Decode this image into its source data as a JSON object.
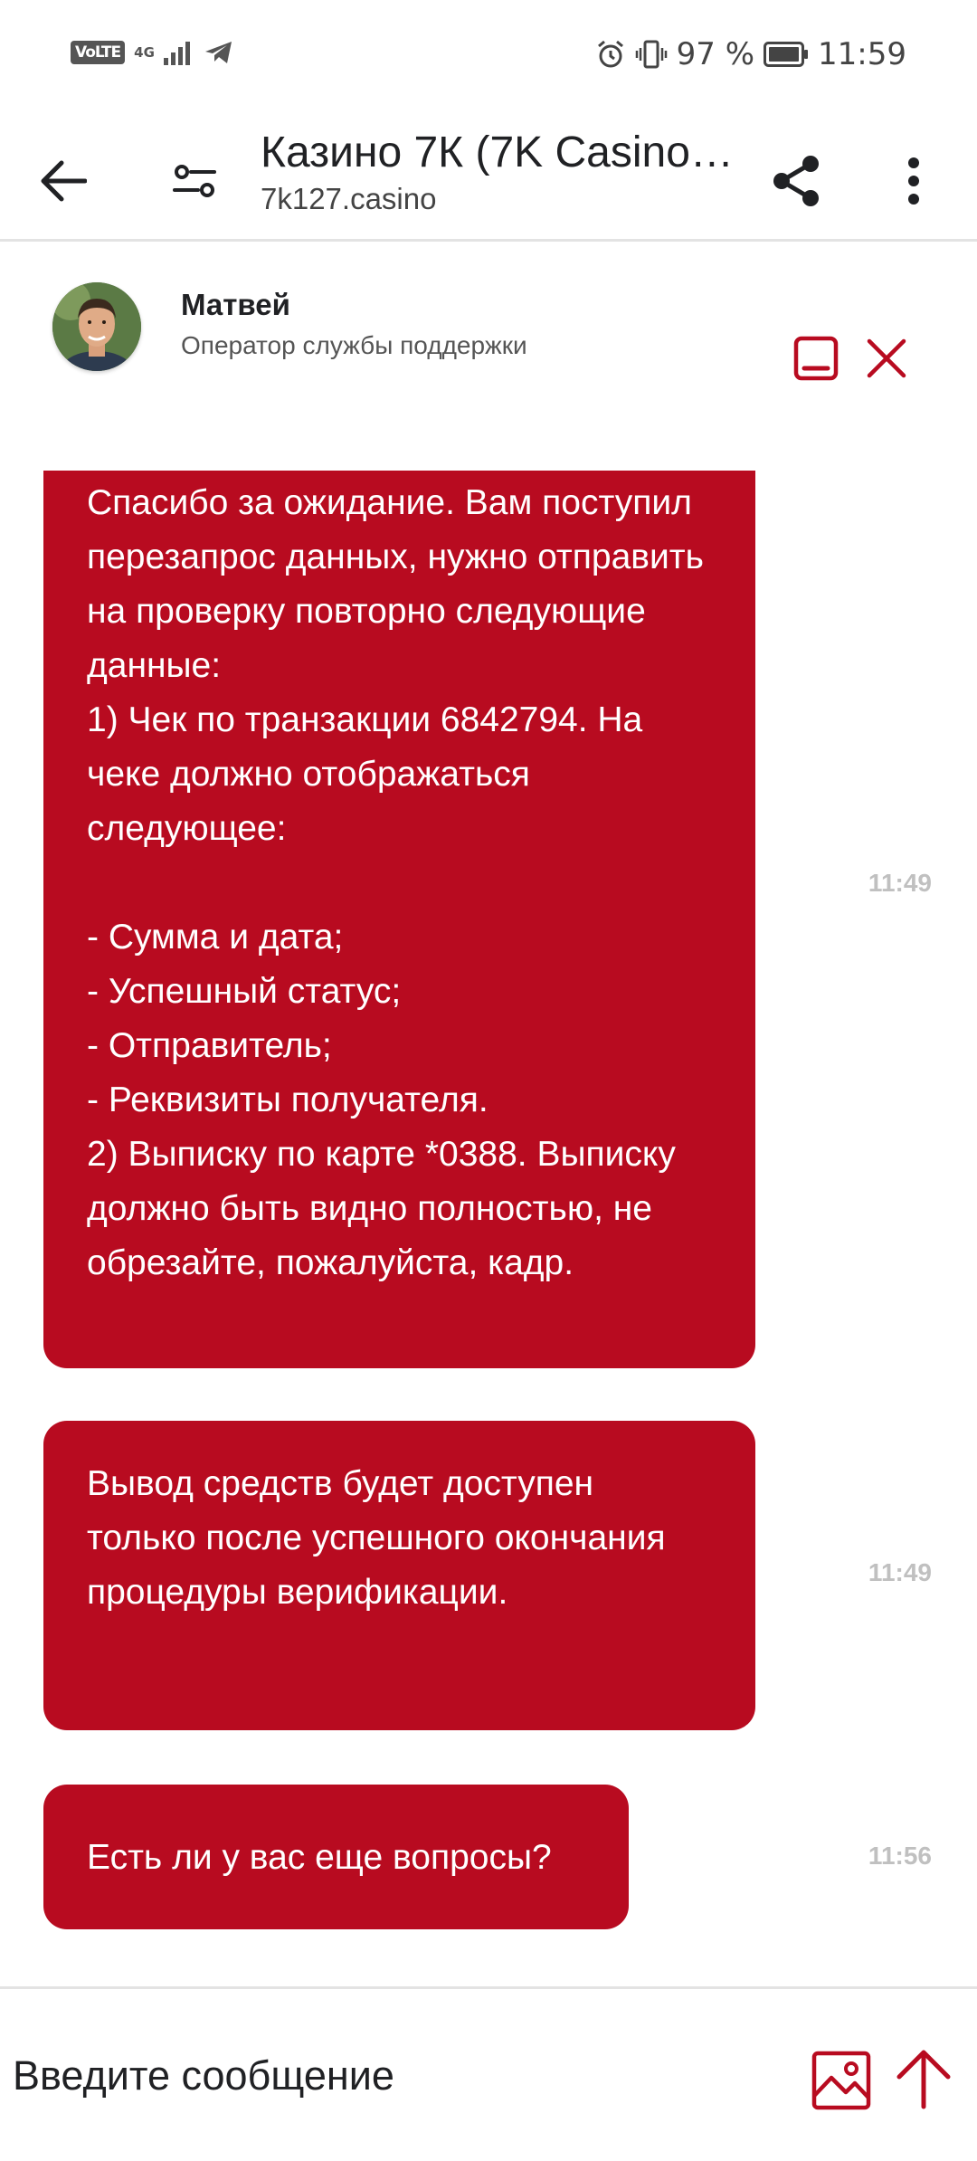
{
  "status_bar": {
    "volte": "VoLTE",
    "network": "4G",
    "battery_percent": "97 %",
    "time": "11:59",
    "icons": [
      "volte-icon",
      "signal-icon",
      "telegram-icon",
      "alarm-icon",
      "vibrate-icon",
      "battery-icon"
    ]
  },
  "header": {
    "title": "Казино 7К (7K Casino…",
    "url": "7k127.casino",
    "icons": [
      "back-arrow-icon",
      "tune-icon",
      "share-icon",
      "more-vert-icon"
    ]
  },
  "operator": {
    "name": "Матвей",
    "role": "Оператор службы поддержки",
    "icons": [
      "minimize-icon",
      "close-icon"
    ]
  },
  "messages": [
    {
      "text": "Спасибо за ожидание. Вам поступил перезапрос данных, нужно отправить на проверку повторно следующие данные:\n1) Чек по транзакции 6842794. На чеке должно отображаться следующее:\n\n- Сумма и дата;\n- Успешный статус;\n- Отправитель;\n- Реквизиты получателя.\n2) Выписку по карте *0388. Выписку должно быть видно полностью, не обрезайте, пожалуйста, кадр.",
      "time": "11:49"
    },
    {
      "text": "Вывод средств будет доступен только после успешного окончания процедуры верификации.",
      "time": "11:49"
    },
    {
      "text": "Есть ли у вас еще вопросы?",
      "time": "11:56"
    }
  ],
  "input": {
    "placeholder": "Введите сообщение",
    "value": ""
  },
  "colors": {
    "accent": "#b80b20",
    "bubble_text": "#ffffff",
    "time_text": "#c0c0c0"
  }
}
